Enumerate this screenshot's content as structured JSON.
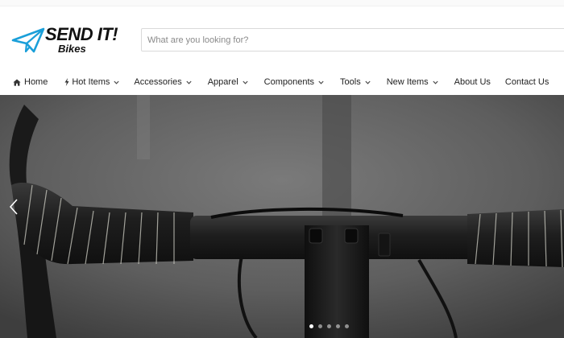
{
  "header": {
    "brand_name": "SEND IT!",
    "brand_sub": "Bikes",
    "logo_icon": "paper-plane-icon",
    "brand_color": "#1a9fd9"
  },
  "search": {
    "placeholder": "What are you looking for?",
    "value": ""
  },
  "nav": {
    "items": [
      {
        "label": "Home",
        "icon": "home-icon",
        "dropdown": false
      },
      {
        "label": "Hot Items",
        "icon": "bolt-icon",
        "dropdown": true
      },
      {
        "label": "Accessories",
        "dropdown": true
      },
      {
        "label": "Apparel",
        "dropdown": true
      },
      {
        "label": "Components",
        "dropdown": true
      },
      {
        "label": "Tools",
        "dropdown": true
      },
      {
        "label": "New Items",
        "dropdown": true
      },
      {
        "label": "About Us",
        "dropdown": false
      },
      {
        "label": "Contact Us",
        "dropdown": false
      }
    ]
  },
  "hero": {
    "image": "bicycle handlebar close-up",
    "slide_count": 5,
    "active_slide": 1,
    "prev_icon": "chevron-left-icon"
  }
}
